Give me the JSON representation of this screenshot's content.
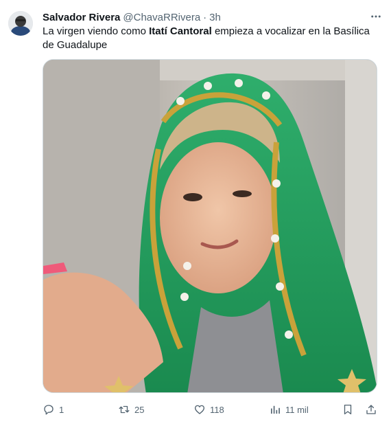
{
  "author": {
    "name": "Salvador Rivera",
    "handle": "@ChavaRRivera",
    "separator": "·",
    "time": "3h"
  },
  "post": {
    "text_before": "La virgen viendo como ",
    "text_bold": "Itatí Cantoral",
    "text_after": " empieza a vocalizar en la Basílica de Guadalupe"
  },
  "actions": {
    "replies": "1",
    "reposts": "25",
    "likes": "118",
    "views": "11 mil"
  },
  "colors": {
    "text": "#0f1419",
    "muted": "#536471",
    "veil_green": "#1f9a5a",
    "gold_trim": "#c9a23a"
  },
  "icons": [
    "more-icon",
    "reply-icon",
    "repost-icon",
    "like-icon",
    "views-icon",
    "bookmark-icon",
    "share-icon"
  ]
}
